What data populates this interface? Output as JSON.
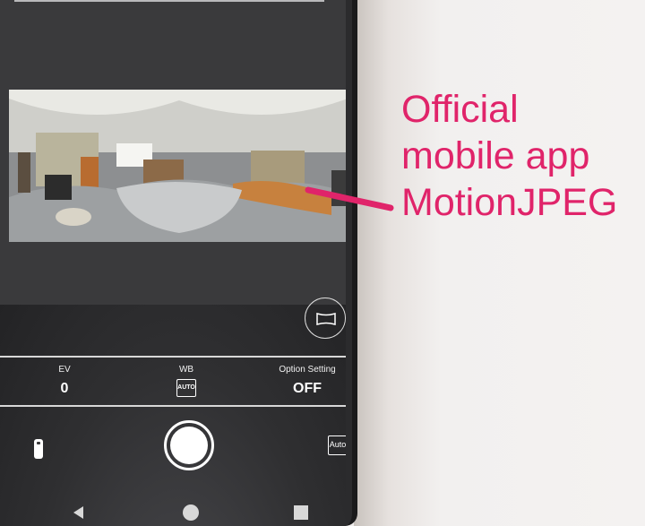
{
  "controls": {
    "ev": {
      "label": "EV",
      "value": "0"
    },
    "wb": {
      "label": "WB",
      "value": "AUTO"
    },
    "option": {
      "label": "Option Setting",
      "value": "OFF"
    }
  },
  "mode_button": {
    "label": "Auto"
  },
  "annotation": {
    "lines": [
      "Official",
      "mobile app",
      "MotionJPEG"
    ],
    "color": "#e0246a"
  },
  "nav": {
    "back": "back-icon",
    "home": "home-icon",
    "recents": "recents-icon"
  }
}
